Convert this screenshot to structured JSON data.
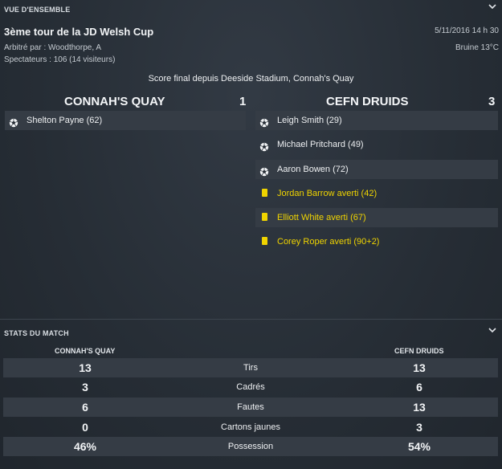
{
  "overview": {
    "section_title": "VUE D'ENSEMBLE",
    "competition": "3ème tour de la JD Welsh Cup",
    "referee": "Arbitré par : Woodthorpe, A",
    "attendance": "Spectateurs : 106 (14 visiteurs)",
    "datetime": "5/11/2016 14 h 30",
    "weather": "Bruine 13°C",
    "headline": "Score final depuis Deeside Stadium, Connah's Quay"
  },
  "home": {
    "name": "CONNAH'S QUAY",
    "score": "1",
    "events": [
      {
        "type": "goal",
        "text": "Shelton Payne (62)"
      }
    ]
  },
  "away": {
    "name": "CEFN DRUIDS",
    "score": "3",
    "events": [
      {
        "type": "goal",
        "text": "Leigh Smith (29)"
      },
      {
        "type": "goal",
        "text": "Michael Pritchard (49)"
      },
      {
        "type": "goal",
        "text": "Aaron Bowen (72)"
      },
      {
        "type": "yellow",
        "text": "Jordan Barrow averti (42)"
      },
      {
        "type": "yellow",
        "text": "Elliott White averti (67)"
      },
      {
        "type": "yellow",
        "text": "Corey Roper averti (90+2)"
      }
    ]
  },
  "stats": {
    "section_title": "STATS DU MATCH",
    "home_label": "CONNAH'S QUAY",
    "away_label": "CEFN DRUIDS",
    "rows": [
      {
        "label": "Tirs",
        "home": "13",
        "away": "13"
      },
      {
        "label": "Cadrés",
        "home": "3",
        "away": "6"
      },
      {
        "label": "Fautes",
        "home": "6",
        "away": "13"
      },
      {
        "label": "Cartons jaunes",
        "home": "0",
        "away": "3"
      },
      {
        "label": "Possession",
        "home": "46%",
        "away": "54%"
      }
    ]
  },
  "colors": {
    "background": "#262d35",
    "row_shade": "#353c45",
    "yellow_card": "#f0d400",
    "text": "#eef0f2"
  },
  "icons": {
    "goal": "soccer-ball-icon",
    "yellow": "yellow-card-icon",
    "collapse": "chevron-down-icon"
  }
}
